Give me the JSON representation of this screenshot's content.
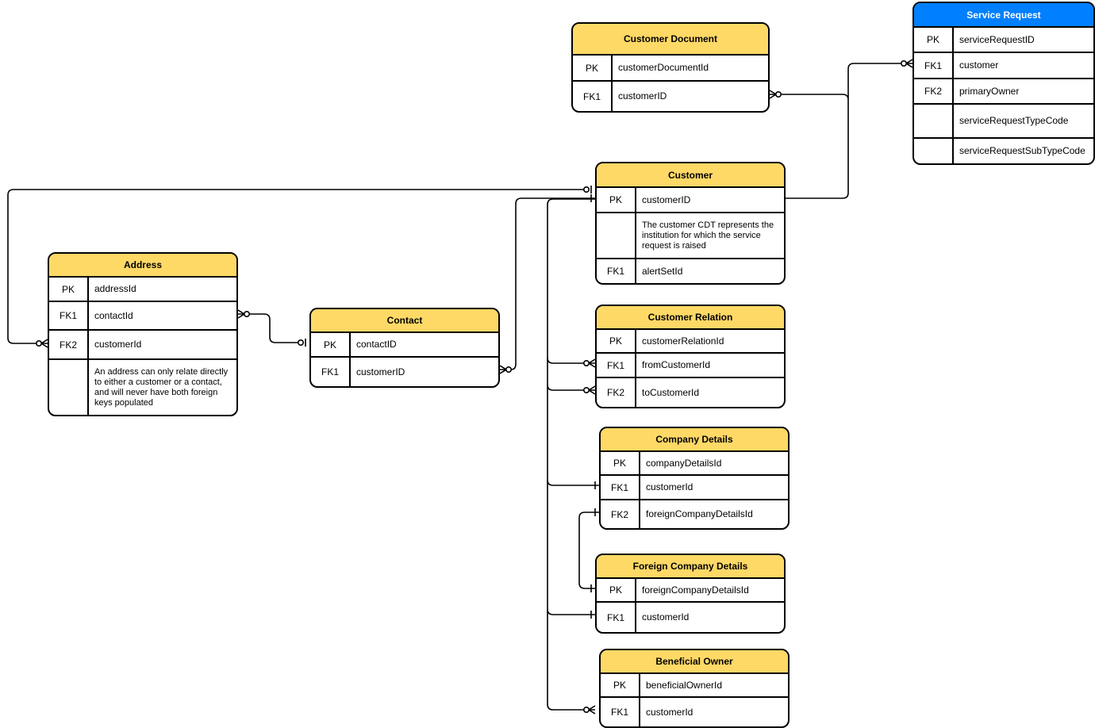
{
  "colors": {
    "header": "#FFD966",
    "header_highlight": "#007FFF",
    "line": "#000000"
  },
  "entities": [
    {
      "id": "customer-document",
      "title": "Customer Document",
      "rows": [
        {
          "key": "PK",
          "name": "customerDocumentId"
        },
        {
          "key": "FK1",
          "name": "customerID"
        }
      ]
    },
    {
      "id": "service-request",
      "title": "Service Request",
      "highlight": true,
      "rows": [
        {
          "key": "PK",
          "name": "serviceRequestID"
        },
        {
          "key": "FK1",
          "name": "customer"
        },
        {
          "key": "FK2",
          "name": "primaryOwner"
        },
        {
          "key": "",
          "name": "serviceRequestTypeCode"
        },
        {
          "key": "",
          "name": "serviceRequestSubTypeCode"
        }
      ]
    },
    {
      "id": "customer",
      "title": "Customer",
      "rows": [
        {
          "key": "PK",
          "name": "customerID"
        },
        {
          "key": "",
          "name": "The customer CDT represents the institution for which the service request is raised",
          "note": true
        },
        {
          "key": "FK1",
          "name": "alertSetId"
        }
      ]
    },
    {
      "id": "address",
      "title": "Address",
      "rows": [
        {
          "key": "PK",
          "name": "addressId"
        },
        {
          "key": "FK1",
          "name": "contactId"
        },
        {
          "key": "FK2",
          "name": "customerId"
        },
        {
          "key": "",
          "name": "An address can only relate directly to either a customer or a contact, and will never have both foreign keys populated",
          "note": true
        }
      ]
    },
    {
      "id": "contact",
      "title": "Contact",
      "rows": [
        {
          "key": "PK",
          "name": "contactID"
        },
        {
          "key": "FK1",
          "name": "customerID"
        }
      ]
    },
    {
      "id": "customer-relation",
      "title": "Customer Relation",
      "rows": [
        {
          "key": "PK",
          "name": "customerRelationId"
        },
        {
          "key": "FK1",
          "name": "fromCustomerId"
        },
        {
          "key": "FK2",
          "name": "toCustomerId"
        }
      ]
    },
    {
      "id": "company-details",
      "title": "Company Details",
      "rows": [
        {
          "key": "PK",
          "name": "companyDetailsId"
        },
        {
          "key": "FK1",
          "name": "customerId"
        },
        {
          "key": "FK2",
          "name": "foreignCompanyDetailsId"
        }
      ]
    },
    {
      "id": "foreign-company-details",
      "title": "Foreign Company Details",
      "rows": [
        {
          "key": "PK",
          "name": "foreignCompanyDetailsId"
        },
        {
          "key": "FK1",
          "name": "customerId"
        }
      ]
    },
    {
      "id": "beneficial-owner",
      "title": "Beneficial Owner",
      "rows": [
        {
          "key": "PK",
          "name": "beneficialOwnerId"
        },
        {
          "key": "FK1",
          "name": "customerId"
        }
      ]
    }
  ],
  "relationships": [
    {
      "from": "customer-document.customerID",
      "to": "customer.customerID",
      "from_card": "zero-or-many",
      "to_card": "one"
    },
    {
      "from": "service-request.customer",
      "to": "customer.customerID",
      "from_card": "zero-or-many",
      "to_card": "one"
    },
    {
      "from": "address.customerId",
      "to": "customer.customerID",
      "from_card": "zero-or-many",
      "to_card": "zero-or-one"
    },
    {
      "from": "address.contactId",
      "to": "contact.contactID",
      "from_card": "zero-or-many",
      "to_card": "zero-or-one"
    },
    {
      "from": "contact.customerID",
      "to": "customer.customerID",
      "from_card": "zero-or-many",
      "to_card": "one"
    },
    {
      "from": "customer-relation.fromCustomerId",
      "to": "customer.customerID",
      "from_card": "zero-or-many",
      "to_card": "one"
    },
    {
      "from": "customer-relation.toCustomerId",
      "to": "customer.customerID",
      "from_card": "zero-or-many",
      "to_card": "one"
    },
    {
      "from": "company-details.customerId",
      "to": "customer.customerID",
      "from_card": "one",
      "to_card": "one"
    },
    {
      "from": "company-details.foreignCompanyDetailsId",
      "to": "foreign-company-details.foreignCompanyDetailsId",
      "from_card": "one",
      "to_card": "one"
    },
    {
      "from": "foreign-company-details.customerId",
      "to": "customer.customerID",
      "from_card": "one",
      "to_card": "one"
    },
    {
      "from": "beneficial-owner.customerId",
      "to": "customer.customerID",
      "from_card": "zero-or-many",
      "to_card": "one"
    }
  ]
}
